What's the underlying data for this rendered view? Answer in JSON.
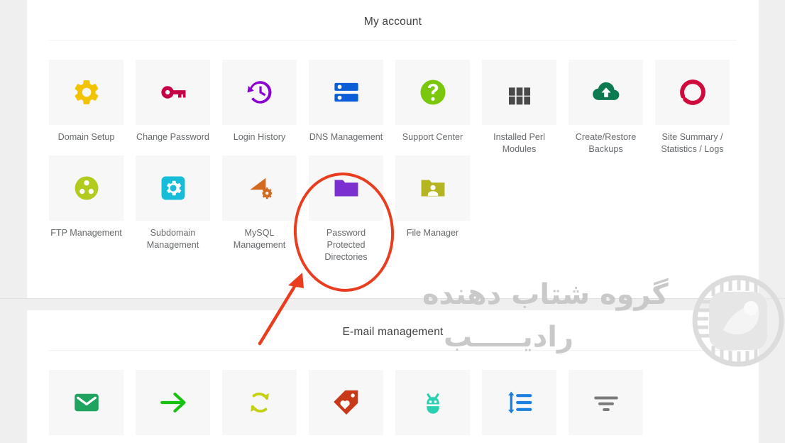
{
  "sections": [
    {
      "id": "my-account",
      "title": "My account",
      "tiles": [
        {
          "label": "Domain Setup",
          "icon": "gear-icon",
          "color": "#f2c300"
        },
        {
          "label": "Change Password",
          "icon": "key-icon",
          "color": "#c60047"
        },
        {
          "label": "Login History",
          "icon": "history-clock-icon",
          "color": "#8a00d4"
        },
        {
          "label": "DNS Management",
          "icon": "server-stack-icon",
          "color": "#0b5ed7"
        },
        {
          "label": "Support Center",
          "icon": "question-circle-icon",
          "color": "#7ac70c"
        },
        {
          "label": "Installed Perl Modules",
          "icon": "grid-modules-icon",
          "color": "#4a4a4a"
        },
        {
          "label": "Create/Restore Backups",
          "icon": "cloud-upload-icon",
          "color": "#0d7a4f"
        },
        {
          "label": "Site Summary / Statistics / Logs",
          "icon": "donut-chart-icon",
          "color": "#cf0a3c"
        },
        {
          "label": "FTP Management",
          "icon": "three-dot-circle-icon",
          "color": "#b2cb1e"
        },
        {
          "label": "Subdomain Management",
          "icon": "gear-square-icon",
          "color": "#17bdd8"
        },
        {
          "label": "MySQL Management",
          "icon": "mysql-dolphin-icon",
          "color": "#d2691e"
        },
        {
          "label": "Password Protected Directories",
          "icon": "folder-icon",
          "color": "#7b2fcf"
        },
        {
          "label": "File Manager",
          "icon": "folder-user-icon",
          "color": "#b5b521"
        }
      ]
    },
    {
      "id": "email-management",
      "title": "E-mail management",
      "tiles": [
        {
          "label": "",
          "icon": "envelope-icon",
          "color": "#1fa45f"
        },
        {
          "label": "",
          "icon": "arrow-right-icon",
          "color": "#16c20f"
        },
        {
          "label": "",
          "icon": "sync-refresh-icon",
          "color": "#c3d112"
        },
        {
          "label": "",
          "icon": "tag-heart-icon",
          "color": "#c8391a"
        },
        {
          "label": "",
          "icon": "bug-icon",
          "color": "#2ad0b0"
        },
        {
          "label": "",
          "icon": "list-sort-icon",
          "color": "#1a7fe0"
        },
        {
          "label": "",
          "icon": "filter-icon",
          "color": "#7a7a7a"
        }
      ]
    }
  ],
  "annotations": {
    "highlight_ellipse_target": "MySQL Management",
    "ellipse_color": "#ea3d1f",
    "arrow_color": "#ea3d1f"
  },
  "watermark": {
    "line1": "گروه شتاب دهنده",
    "line2": "رادیـــــب",
    "color": "#c9c9c9"
  }
}
